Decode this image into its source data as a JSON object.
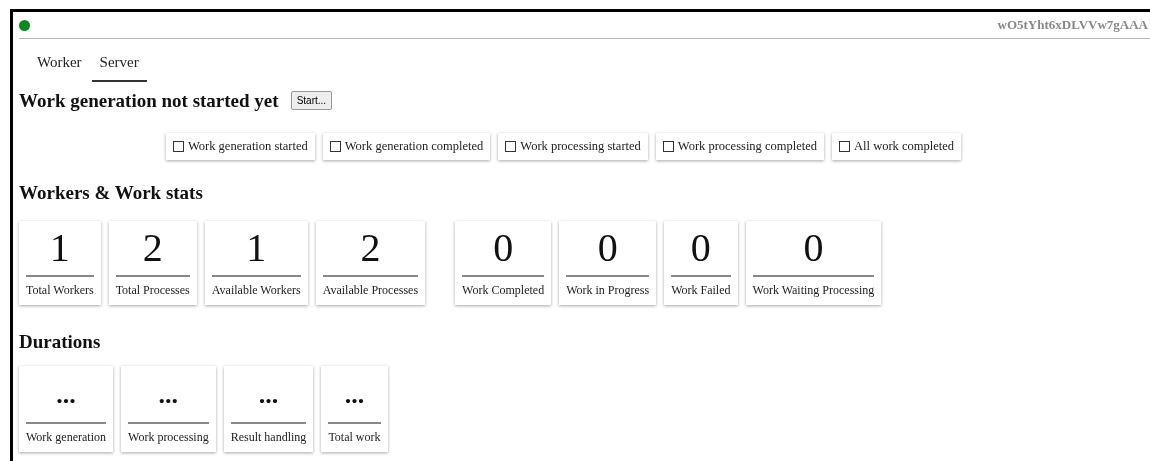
{
  "status": {
    "connected": true
  },
  "client_id": "wO5tYht6xDLVVw7gAAA",
  "tabs": [
    {
      "label": "Worker",
      "selected": false
    },
    {
      "label": "Server",
      "selected": true
    }
  ],
  "generation": {
    "title": "Work generation not started yet",
    "button": "Start..."
  },
  "milestones": [
    {
      "label": "Work generation started",
      "checked": false
    },
    {
      "label": "Work generation completed",
      "checked": false
    },
    {
      "label": "Work processing started",
      "checked": false
    },
    {
      "label": "Work processing completed",
      "checked": false
    },
    {
      "label": "All work completed",
      "checked": false
    }
  ],
  "stats": {
    "title": "Workers & Work stats",
    "groups": [
      [
        {
          "value": "1",
          "label": "Total Workers"
        },
        {
          "value": "2",
          "label": "Total Processes"
        },
        {
          "value": "1",
          "label": "Available Workers"
        },
        {
          "value": "2",
          "label": "Available Processes"
        }
      ],
      [
        {
          "value": "0",
          "label": "Work Completed"
        },
        {
          "value": "0",
          "label": "Work in Progress"
        },
        {
          "value": "0",
          "label": "Work Failed"
        },
        {
          "value": "0",
          "label": "Work Waiting Processing"
        }
      ]
    ]
  },
  "durations": {
    "title": "Durations",
    "items": [
      {
        "value": "...",
        "label": "Work generation"
      },
      {
        "value": "...",
        "label": "Work processing"
      },
      {
        "value": "...",
        "label": "Result handling"
      },
      {
        "value": "...",
        "label": "Total work"
      }
    ]
  }
}
